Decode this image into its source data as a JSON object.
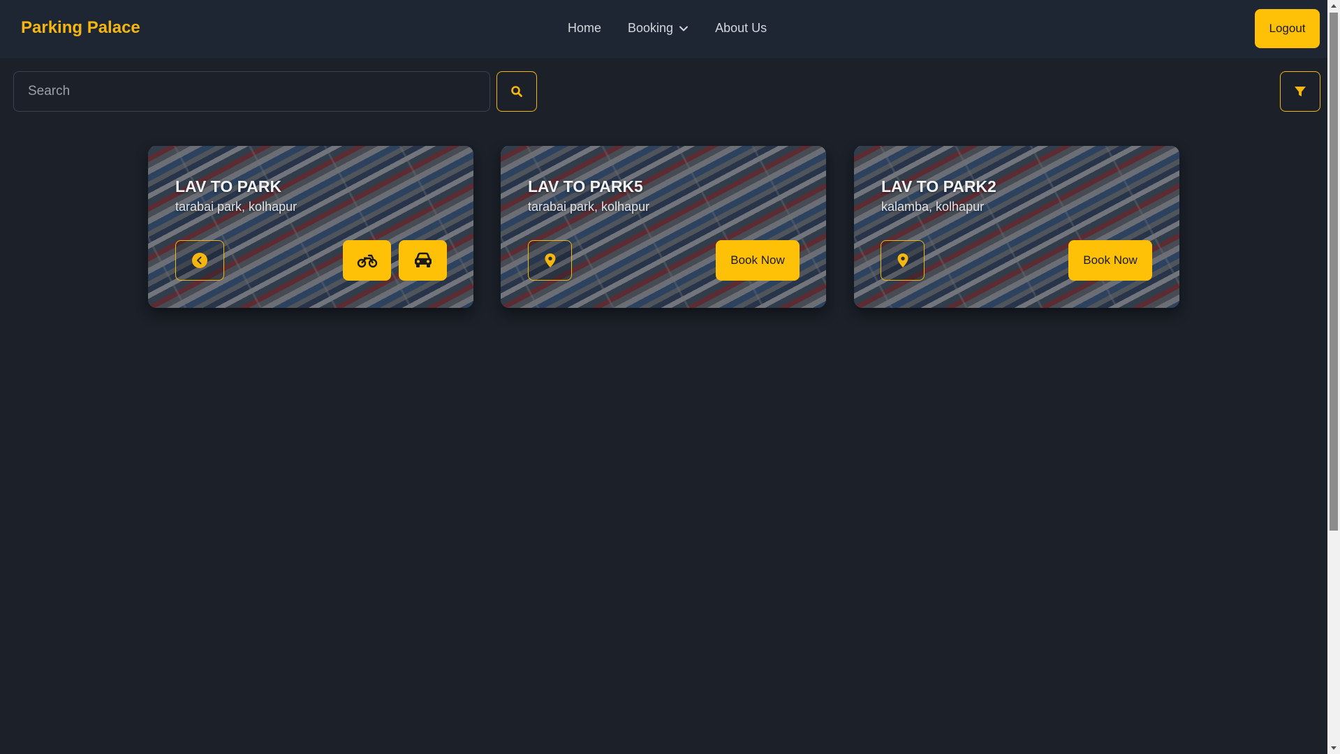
{
  "header": {
    "brand": "Parking Palace",
    "nav": [
      {
        "label": "Home"
      },
      {
        "label": "Booking"
      },
      {
        "label": "About Us"
      }
    ],
    "logout_label": "Logout"
  },
  "search": {
    "placeholder": "Search",
    "value": ""
  },
  "cards": [
    {
      "title": "LAV TO PARK",
      "location": "tarabai park, kolhapur",
      "actions": [
        "back-icon",
        "motorcycle-icon",
        "car-icon"
      ]
    },
    {
      "title": "LAV TO PARK5",
      "location": "tarabai park, kolhapur",
      "book_label": "Book Now",
      "actions": [
        "location-pin-icon"
      ]
    },
    {
      "title": "LAV TO PARK2",
      "location": "kalamba, kolhapur",
      "book_label": "Book Now",
      "actions": [
        "location-pin-icon"
      ]
    }
  ],
  "colors": {
    "background": "#1b2029",
    "navbar": "#1e2533",
    "accent": "#fec107",
    "brand": "#f5b70f"
  }
}
